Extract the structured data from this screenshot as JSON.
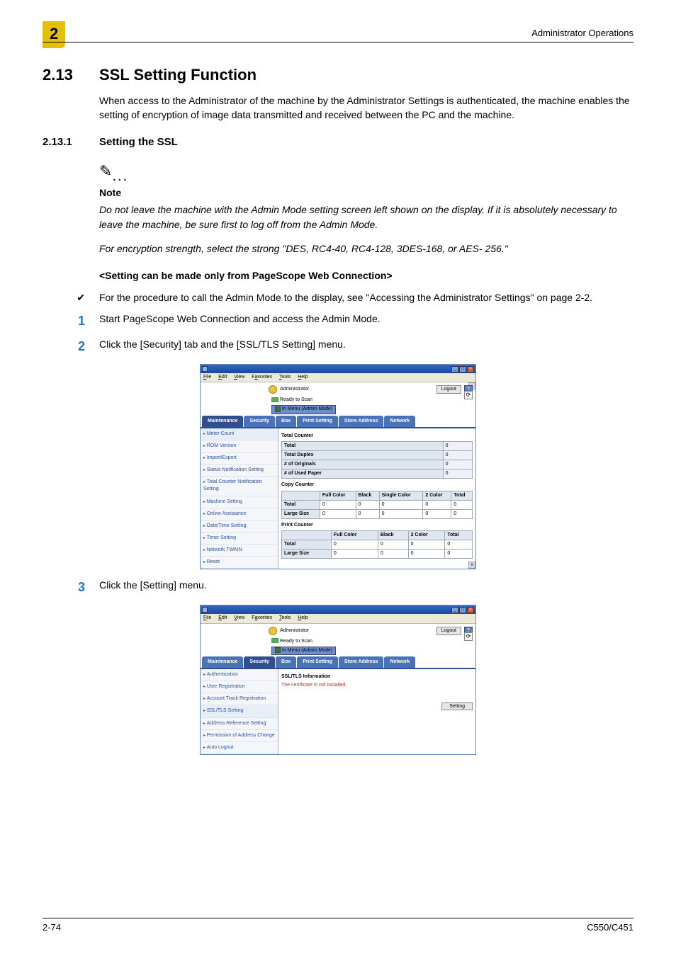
{
  "header": {
    "right": "Administrator Operations",
    "chapter": "2"
  },
  "section": {
    "num": "2.13",
    "title": "SSL Setting Function"
  },
  "intro": "When access to the Administrator of the machine by the Administrator Settings is authenticated, the machine enables the setting of encryption of image data transmitted and received between the PC and the machine.",
  "sub": {
    "num": "2.13.1",
    "title": "Setting the SSL"
  },
  "note": {
    "label": "Note",
    "p1": "Do not leave the machine with the Admin Mode setting screen left shown on the display. If it is absolutely necessary to leave the machine, be sure first to log off from the Admin Mode.",
    "p2": "For encryption strength, select the strong \"DES, RC4-40, RC4-128, 3DES-168, or AES- 256.\""
  },
  "setting_can": "<Setting can be made only from PageScope Web Connection>",
  "bullet": "For the procedure to call the Admin Mode to the display, see \"Accessing the Administrator Settings\" on page 2-2.",
  "steps": {
    "s1": "Start PageScope Web Connection and access the Admin Mode.",
    "s2": "Click the [Security] tab and the [SSL/TLS Setting] menu.",
    "s3": "Click the [Setting] menu."
  },
  "win_menu": {
    "file": "File",
    "edit": "Edit",
    "view": "View",
    "fav": "Favorites",
    "tools": "Tools",
    "help": "Help"
  },
  "ui1": {
    "admin": "Administrator",
    "logout": "Logout",
    "ready": "Ready to Scan",
    "menu": "In Menu  (Admin Mode)",
    "tabs": [
      "Maintenance",
      "Security",
      "Box",
      "Print Setting",
      "Store Address",
      "Network"
    ],
    "sidebar": [
      "Meter Count",
      "ROM Version",
      "Import/Export",
      "Status Notification Setting",
      "Total Counter Notification Setting",
      "Machine Setting",
      "Online Assistance",
      "Date/Time Setting",
      "Timer Setting",
      "Network TWAIN",
      "Reset"
    ],
    "sections": {
      "total_counter": {
        "title": "Total Counter",
        "rows": [
          {
            "label": "Total",
            "val": "0"
          },
          {
            "label": "Total Duplex",
            "val": "0"
          },
          {
            "label": "# of Originals",
            "val": "0"
          },
          {
            "label": "# of Used Paper",
            "val": "0"
          }
        ]
      },
      "copy_counter": {
        "title": "Copy Counter",
        "cols": [
          "",
          "Full Color",
          "Black",
          "Single Color",
          "2 Color",
          "Total"
        ],
        "rows": [
          {
            "label": "Total",
            "vals": [
              "0",
              "0",
              "0",
              "0",
              "0"
            ]
          },
          {
            "label": "Large Size",
            "vals": [
              "0",
              "0",
              "0",
              "0",
              "0"
            ]
          }
        ]
      },
      "print_counter": {
        "title": "Print Counter",
        "cols": [
          "",
          "Full Color",
          "Black",
          "2 Color",
          "Total"
        ],
        "rows": [
          {
            "label": "Total",
            "vals": [
              "0",
              "0",
              "0",
              "0"
            ]
          },
          {
            "label": "Large Size",
            "vals": [
              "0",
              "0",
              "0",
              "0"
            ]
          }
        ]
      }
    }
  },
  "ui2": {
    "admin": "Administrator",
    "logout": "Logout",
    "ready": "Ready to Scan",
    "menu": "In Menu  (Admin Mode)",
    "tabs": [
      "Maintenance",
      "Security",
      "Box",
      "Print Setting",
      "Store Address",
      "Network"
    ],
    "sidebar": [
      "Authentication",
      "User Registration",
      "Account Track Registration",
      "SSL/TLS Setting",
      "Address Reference Setting",
      "Permission of Address Change",
      "Auto Logout"
    ],
    "content_title": "SSL/TLS Information",
    "warn": "The certificate is not installed.",
    "setting_btn": "Setting"
  },
  "footer": {
    "left": "2-74",
    "right": "C550/C451"
  }
}
